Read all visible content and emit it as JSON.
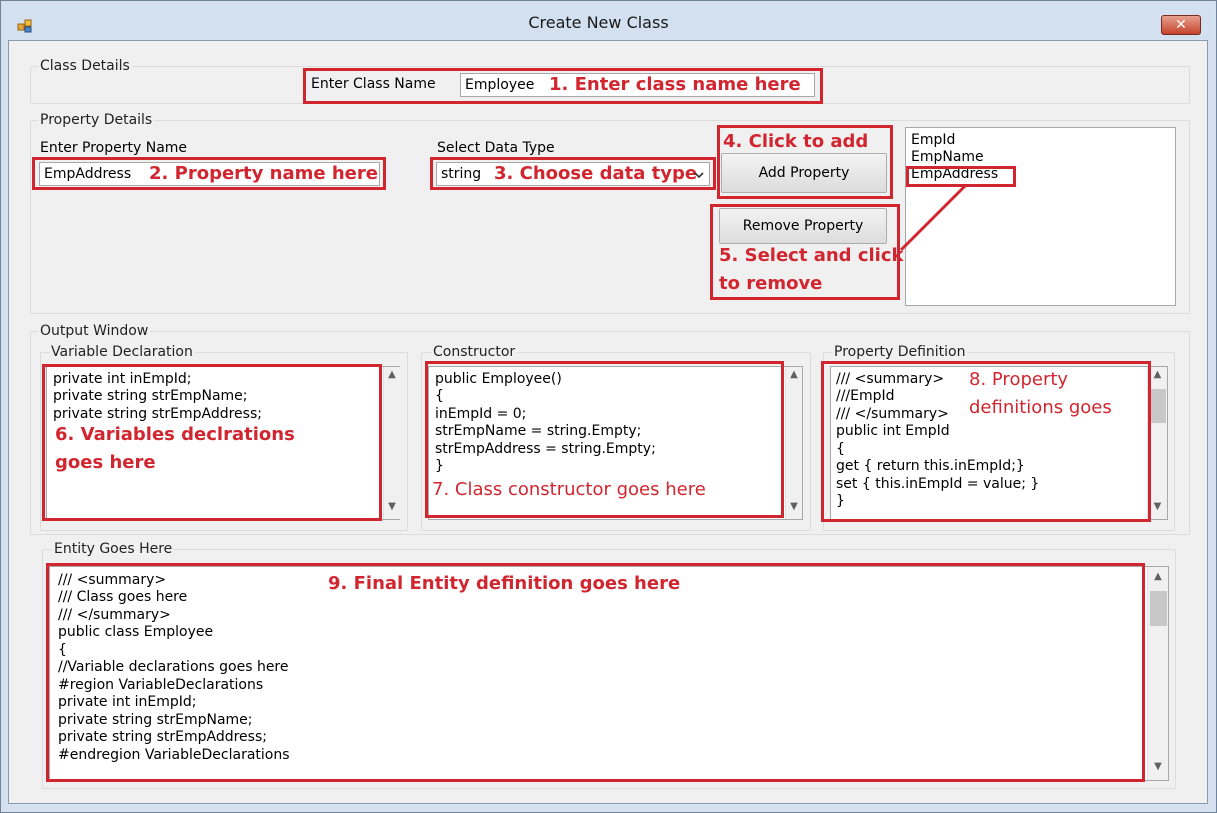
{
  "window": {
    "title": "Create New Class",
    "close_label": "✕"
  },
  "class_details": {
    "group_label": "Class Details",
    "name_label": "Enter Class Name",
    "name_value": "Employee",
    "annotation": "1. Enter class name here"
  },
  "property_details": {
    "group_label": "Property Details",
    "name_label": "Enter Property Name",
    "name_value": "EmpAddress",
    "name_annotation": "2. Property name here",
    "type_label": "Select Data Type",
    "type_value": "string",
    "type_annotation": "3. Choose data type",
    "add_annotation": "4. Click to add",
    "add_button": "Add Property",
    "remove_button": "Remove Property",
    "remove_annotation_line1": "5. Select and click",
    "remove_annotation_line2": "to remove",
    "properties": [
      "EmpId",
      "EmpName",
      "EmpAddress"
    ]
  },
  "output_window": {
    "group_label": "Output Window",
    "variable_declaration": {
      "label": "Variable Declaration",
      "lines": [
        "private int inEmpId;",
        "private string strEmpName;",
        "private string strEmpAddress;"
      ],
      "annotation_line1": "6. Variables declrations",
      "annotation_line2": "goes here"
    },
    "constructor": {
      "label": "Constructor",
      "lines": [
        "public Employee()",
        "{",
        "inEmpId = 0;",
        "strEmpName = string.Empty;",
        "strEmpAddress = string.Empty;",
        "}"
      ],
      "annotation": "7. Class constructor goes here"
    },
    "property_definition": {
      "label": "Property Definition",
      "lines": [
        "/// <summary>",
        "///EmpId",
        "/// </summary>",
        "public int EmpId",
        "{",
        "get { return this.inEmpId;}",
        "set { this.inEmpId = value; }",
        "}"
      ],
      "annotation_line1": "8. Property",
      "annotation_line2": "definitions goes"
    }
  },
  "entity": {
    "label": "Entity Goes Here",
    "lines": [
      "/// <summary>",
      "/// Class goes here",
      "/// </summary>",
      "public class Employee",
      "{",
      "//Variable declarations goes here",
      "#region VariableDeclarations",
      "private int inEmpId;",
      "private string strEmpName;",
      "private string strEmpAddress;",
      "#endregion VariableDeclarations"
    ],
    "annotation": "9. Final Entity definition goes here"
  },
  "icons": {
    "dropdown": "chevron-down-icon",
    "scroll_up": "scroll-up-arrow-icon",
    "scroll_down": "scroll-down-arrow-icon"
  },
  "colors": {
    "annotation_red": "#d1262f",
    "window_frame": "#d2e0f0"
  }
}
